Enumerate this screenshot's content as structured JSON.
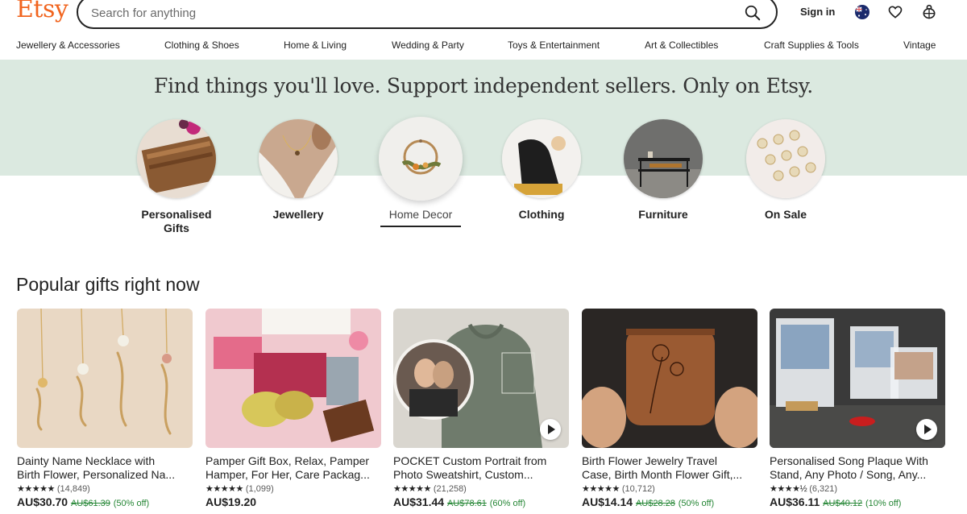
{
  "header": {
    "logo": "Etsy",
    "search_placeholder": "Search for anything",
    "sign_in": "Sign in"
  },
  "nav": [
    "Jewellery & Accessories",
    "Clothing & Shoes",
    "Home & Living",
    "Wedding & Party",
    "Toys & Entertainment",
    "Art & Collectibles",
    "Craft Supplies & Tools",
    "Vintage"
  ],
  "hero": {
    "tagline": "Find things you'll love. Support independent sellers. Only on Etsy.",
    "categories": [
      {
        "line1": "Personalised",
        "line2": "Gifts"
      },
      {
        "line1": "Jewellery",
        "line2": ""
      },
      {
        "line1": "Home Decor",
        "line2": ""
      },
      {
        "line1": "Clothing",
        "line2": ""
      },
      {
        "line1": "Furniture",
        "line2": ""
      },
      {
        "line1": "On Sale",
        "line2": ""
      }
    ]
  },
  "popular": {
    "title": "Popular gifts right now",
    "items": [
      {
        "title1": "Dainty Name Necklace with",
        "title2": "Birth Flower, Personalized Na...",
        "stars": "★★★★★",
        "reviews": "(14,849)",
        "price": "AU$30.70",
        "orig": "AU$61.39",
        "discount": "(50% off)"
      },
      {
        "title1": "Pamper Gift Box, Relax, Pamper",
        "title2": "Hamper, For Her, Care Packag...",
        "stars": "★★★★★",
        "reviews": "(1,099)",
        "price": "AU$19.20",
        "orig": "",
        "discount": ""
      },
      {
        "title1": "POCKET Custom Portrait from",
        "title2": "Photo Sweatshirt, Custom...",
        "stars": "★★★★★",
        "reviews": "(21,258)",
        "price": "AU$31.44",
        "orig": "AU$78.61",
        "discount": "(60% off)"
      },
      {
        "title1": "Birth Flower Jewelry Travel",
        "title2": "Case, Birth Month Flower Gift,...",
        "stars": "★★★★★",
        "reviews": "(10,712)",
        "price": "AU$14.14",
        "orig": "AU$28.28",
        "discount": "(50% off)"
      },
      {
        "title1": "Personalised Song Plaque With",
        "title2": "Stand, Any Photo / Song, Any...",
        "stars": "★★★★½",
        "reviews": "(6,321)",
        "price": "AU$36.11",
        "orig": "AU$40.12",
        "discount": "(10% off)"
      }
    ]
  },
  "colors": {
    "brand": "#f1641e",
    "hero_bg": "#dbe9e0",
    "sale_green": "#258635"
  },
  "icons": [
    "search-icon",
    "australia-flag-icon",
    "heart-icon",
    "shopping-bag-icon",
    "play-icon"
  ]
}
